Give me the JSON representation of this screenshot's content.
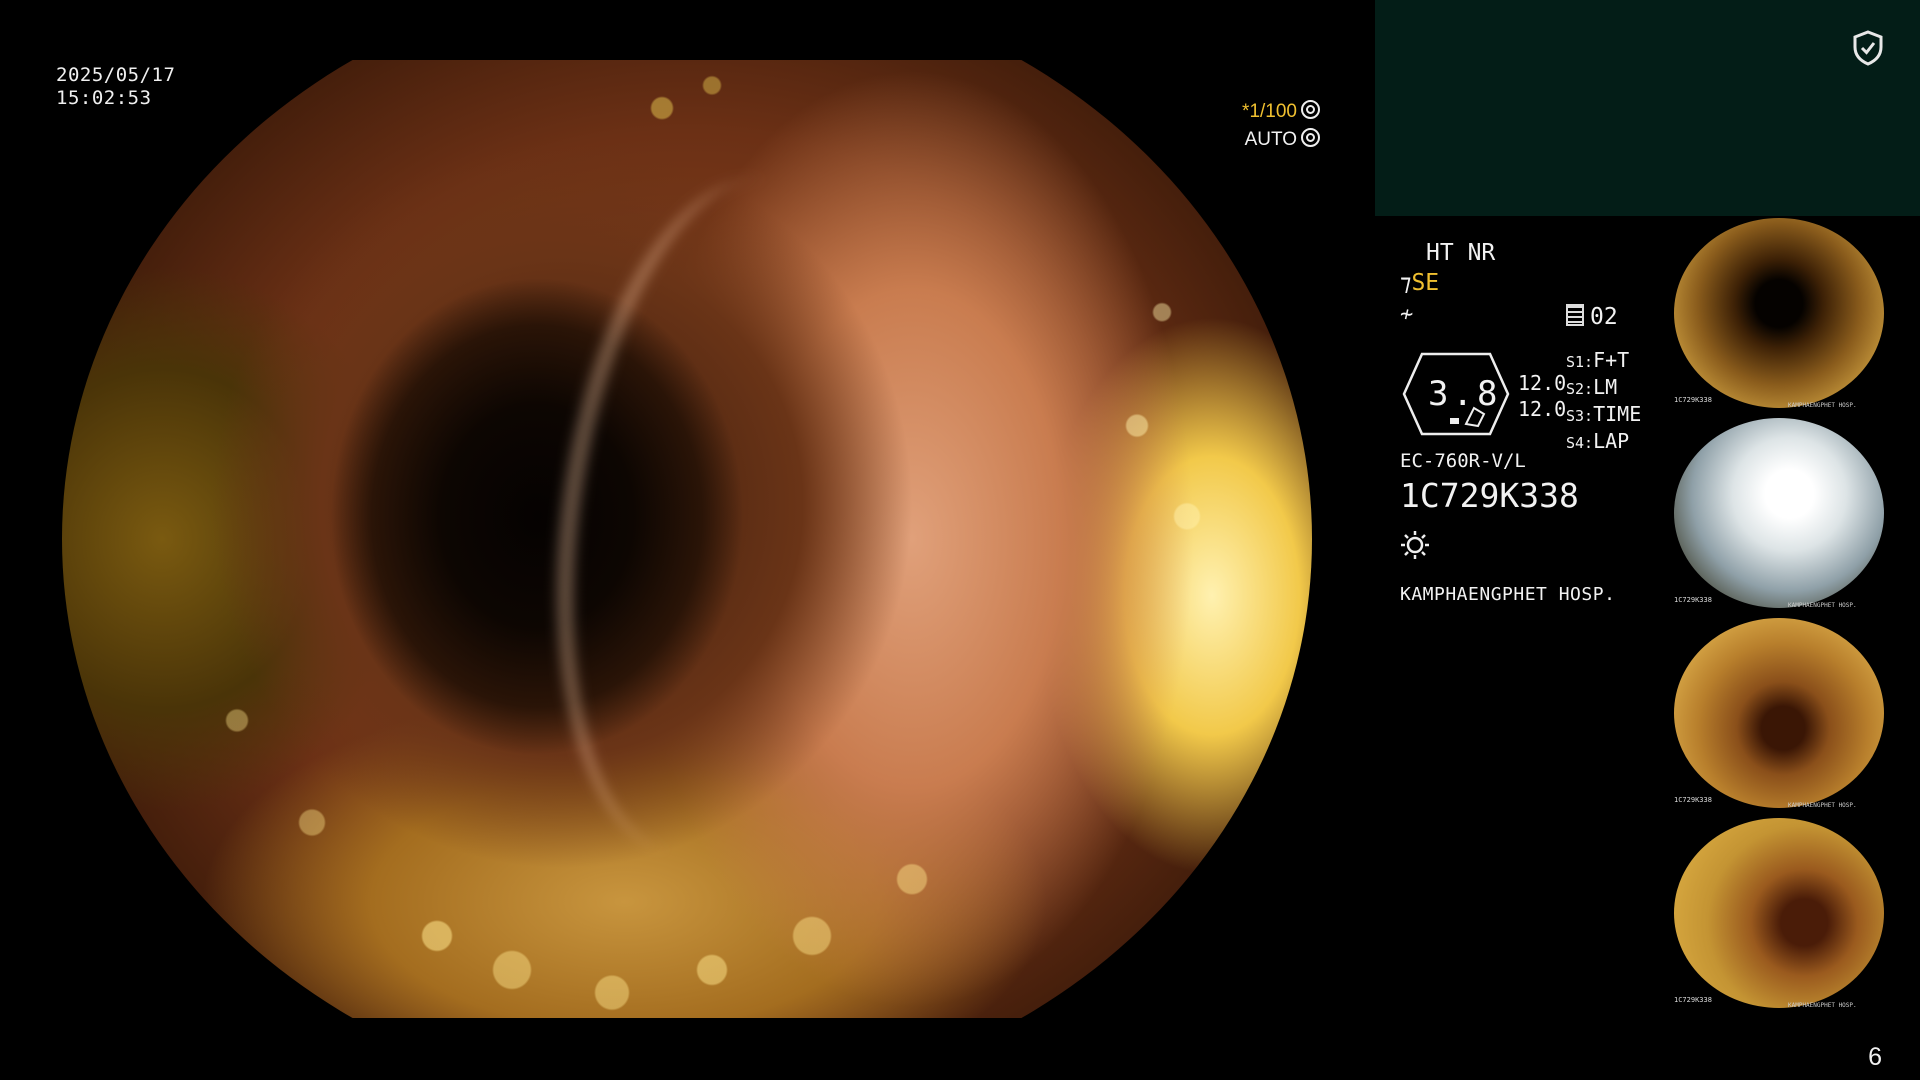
{
  "overlay": {
    "date": "2025/05/17",
    "time": "15:02:53",
    "shutter": "*1/100",
    "auto_label": "AUTO"
  },
  "settings": {
    "ht": "HT",
    "nr": "NR",
    "se": "SE",
    "mode_number": "02",
    "iris_value": "3.8",
    "level_values": [
      "12.0",
      "12.0"
    ],
    "switches": [
      {
        "key": "S1:",
        "value": "F+T"
      },
      {
        "key": "S2:",
        "value": "LM"
      },
      {
        "key": "S3:",
        "value": "TIME"
      },
      {
        "key": "S4:",
        "value": "LAP"
      }
    ],
    "scope_model": "EC-760R-V/L",
    "serial": "1C729K338",
    "hospital": "KAMPHAENGPHET HOSP."
  },
  "thumbnails": [
    {
      "serial": "1C729K338",
      "hospital": "KAMPHAENGPHET HOSP."
    },
    {
      "serial": "1C729K338",
      "hospital": "KAMPHAENGPHET HOSP."
    },
    {
      "serial": "1C729K338",
      "hospital": "KAMPHAENGPHET HOSP."
    },
    {
      "serial": "1C729K338",
      "hospital": "KAMPHAENGPHET HOSP."
    }
  ],
  "page_number": "6",
  "colors": {
    "highlight": "#f0c030",
    "header_panel": "#031d17",
    "background": "#000000"
  },
  "icons": {
    "shield": "shield-check-icon",
    "light": "light-bulb-icon",
    "mode": "memory-icon"
  }
}
